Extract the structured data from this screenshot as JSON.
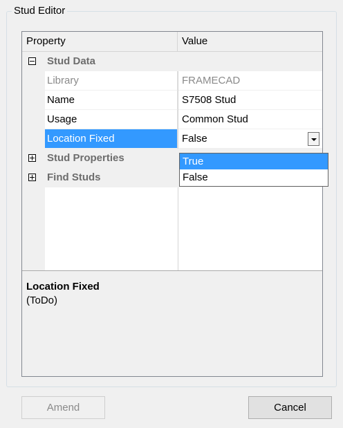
{
  "window": {
    "group_title": "Stud Editor"
  },
  "grid": {
    "headers": {
      "property": "Property",
      "value": "Value"
    },
    "categories": [
      {
        "label": "Stud Data",
        "expanded": true
      },
      {
        "label": "Stud Properties",
        "expanded": false
      },
      {
        "label": "Find Studs",
        "expanded": false
      }
    ],
    "rows": [
      {
        "property": "Library",
        "value": "FRAMECAD"
      },
      {
        "property": "Name",
        "value": "S7508 Stud"
      },
      {
        "property": "Usage",
        "value": "Common Stud"
      },
      {
        "property": "Location Fixed",
        "value": "False"
      }
    ],
    "dropdown_options": [
      "True",
      "False"
    ],
    "dropdown_highlighted": "True"
  },
  "description": {
    "title": "Location Fixed",
    "text": "(ToDo)"
  },
  "buttons": {
    "amend": "Amend",
    "cancel": "Cancel"
  },
  "colors": {
    "selection": "#3399ff",
    "category_text": "#6d6d6d"
  },
  "icons": [
    "minus-expander-icon",
    "plus-expander-icon",
    "dropdown-arrow-icon"
  ]
}
